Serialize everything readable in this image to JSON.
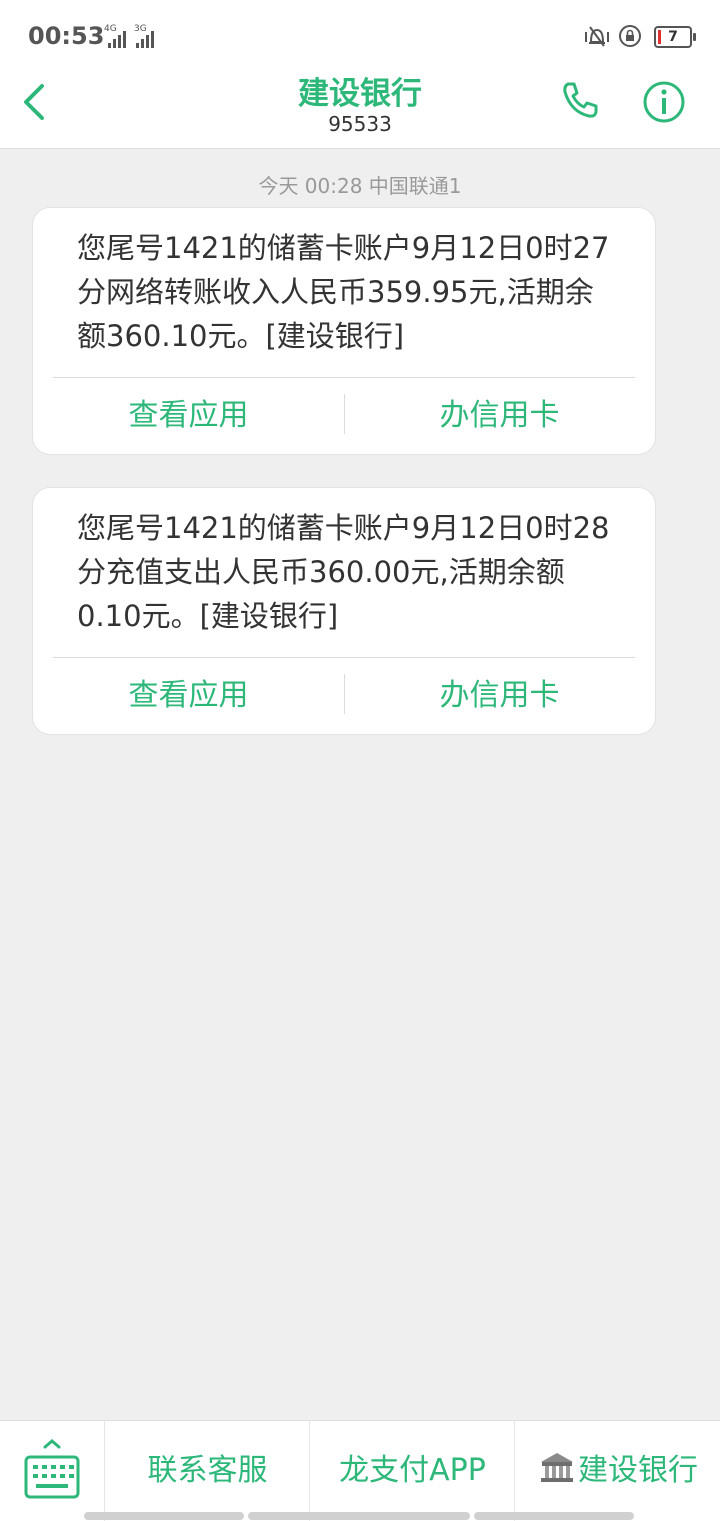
{
  "status_bar": {
    "time": "00:53",
    "sim1_network": "4G",
    "sim2_network": "3G",
    "battery_level": "7",
    "icons": [
      "vibrate-icon",
      "rotation-lock-icon",
      "battery-icon"
    ]
  },
  "header": {
    "title": "建设银行",
    "number": "95533",
    "accent_color": "#2db87a"
  },
  "conversation": {
    "timestamp": "今天 00:28  中国联通1",
    "messages": [
      {
        "text": "您尾号1421的储蓄卡账户9月12日0时27分网络转账收入人民币359.95元,活期余额360.10元。[建设银行]",
        "actions": [
          "查看应用",
          "办信用卡"
        ]
      },
      {
        "text": "您尾号1421的储蓄卡账户9月12日0时28分充值支出人民币360.00元,活期余额0.10元。[建设银行]",
        "actions": [
          "查看应用",
          "办信用卡"
        ]
      }
    ]
  },
  "bottom_menu": {
    "items": [
      "联系客服",
      "龙支付APP",
      "建设银行"
    ],
    "keyboard_icon": "keyboard-icon"
  }
}
